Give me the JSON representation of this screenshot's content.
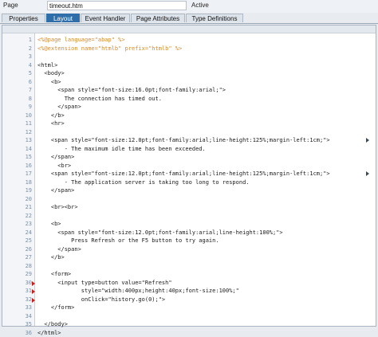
{
  "header": {
    "page_label": "Page",
    "page_value": "timeout.htm",
    "status": "Active"
  },
  "tabs": [
    {
      "label": "Properties",
      "active": false
    },
    {
      "label": "Layout",
      "active": true
    },
    {
      "label": "Event Handler",
      "active": false
    },
    {
      "label": "Page Attributes",
      "active": false
    },
    {
      "label": "Type Definitions",
      "active": false
    }
  ],
  "editor": {
    "lines": [
      {
        "num": "1",
        "text": "<%@page language=\"abap\" %>",
        "color": "#d48a2a",
        "breakpoint": false
      },
      {
        "num": "2",
        "text": "<%@extension name=\"htmlb\" prefix=\"htmlb\" %>",
        "color": "#d48a2a",
        "breakpoint": false
      },
      {
        "num": "3",
        "text": "",
        "color": "#1a1a1a",
        "breakpoint": false
      },
      {
        "num": "4",
        "text": "<html>",
        "color": "#1a1a1a",
        "breakpoint": false
      },
      {
        "num": "5",
        "text": "  <body>",
        "color": "#1a1a1a",
        "breakpoint": false
      },
      {
        "num": "6",
        "text": "    <b>",
        "color": "#1a1a1a",
        "breakpoint": false
      },
      {
        "num": "7",
        "text": "      <span style=\"font-size:16.0pt;font-family:arial;\">",
        "color": "#1a1a1a",
        "breakpoint": false
      },
      {
        "num": "8",
        "text": "        The connection has timed out.",
        "color": "#1a1a1a",
        "breakpoint": false
      },
      {
        "num": "9",
        "text": "      </span>",
        "color": "#1a1a1a",
        "breakpoint": false
      },
      {
        "num": "10",
        "text": "    </b>",
        "color": "#1a1a1a",
        "breakpoint": false
      },
      {
        "num": "11",
        "text": "    <hr>",
        "color": "#1a1a1a",
        "breakpoint": false
      },
      {
        "num": "12",
        "text": "",
        "color": "#1a1a1a",
        "breakpoint": false
      },
      {
        "num": "13",
        "text": "    <span style=\"font-size:12.0pt;font-family:arial;line-height:125%;margin-left:1cm;\">",
        "color": "#1a1a1a",
        "breakpoint": false
      },
      {
        "num": "14",
        "text": "        - The maximum idle time has been exceeded.",
        "color": "#1a1a1a",
        "breakpoint": false
      },
      {
        "num": "15",
        "text": "    </span>",
        "color": "#1a1a1a",
        "breakpoint": false
      },
      {
        "num": "16",
        "text": "      <br>",
        "color": "#1a1a1a",
        "breakpoint": false
      },
      {
        "num": "17",
        "text": "    <span style=\"font-size:12.0pt;font-family:arial;line-height:125%;margin-left:1cm;\">",
        "color": "#1a1a1a",
        "breakpoint": false
      },
      {
        "num": "18",
        "text": "        - The application server is taking too long to respond.",
        "color": "#1a1a1a",
        "breakpoint": false
      },
      {
        "num": "19",
        "text": "    </span>",
        "color": "#1a1a1a",
        "breakpoint": false
      },
      {
        "num": "20",
        "text": "",
        "color": "#1a1a1a",
        "breakpoint": false
      },
      {
        "num": "21",
        "text": "    <br><br>",
        "color": "#1a1a1a",
        "breakpoint": false
      },
      {
        "num": "22",
        "text": "",
        "color": "#1a1a1a",
        "breakpoint": false
      },
      {
        "num": "23",
        "text": "    <b>",
        "color": "#1a1a1a",
        "breakpoint": false
      },
      {
        "num": "24",
        "text": "      <span style=\"font-size:12.0pt;font-family:arial;line-height:100%;\">",
        "color": "#1a1a1a",
        "breakpoint": false
      },
      {
        "num": "25",
        "text": "          Press Refresh or the F5 button to try again.",
        "color": "#1a1a1a",
        "breakpoint": false
      },
      {
        "num": "26",
        "text": "      </span>",
        "color": "#1a1a1a",
        "breakpoint": false
      },
      {
        "num": "27",
        "text": "    </b>",
        "color": "#1a1a1a",
        "breakpoint": false
      },
      {
        "num": "28",
        "text": "",
        "color": "#1a1a1a",
        "breakpoint": false
      },
      {
        "num": "29",
        "text": "    <form>",
        "color": "#1a1a1a",
        "breakpoint": false
      },
      {
        "num": "30",
        "text": "      <input type=button value=\"Refresh\"",
        "color": "#1a1a1a",
        "breakpoint": true
      },
      {
        "num": "31",
        "text": "             style=\"width:400px;height:40px;font-size:100%;\"",
        "color": "#1a1a1a",
        "breakpoint": true
      },
      {
        "num": "32",
        "text": "             onClick=\"history.go(0);\">",
        "color": "#1a1a1a",
        "breakpoint": true
      },
      {
        "num": "33",
        "text": "    </form>",
        "color": "#1a1a1a",
        "breakpoint": false
      },
      {
        "num": "34",
        "text": "",
        "color": "#1a1a1a",
        "breakpoint": false
      },
      {
        "num": "35",
        "text": "  </body>",
        "color": "#1a1a1a",
        "breakpoint": false
      },
      {
        "num": "36",
        "text": "</html>",
        "color": "#1a1a1a",
        "breakpoint": false
      }
    ],
    "overflow_marker_lines": [
      "13",
      "17"
    ]
  }
}
